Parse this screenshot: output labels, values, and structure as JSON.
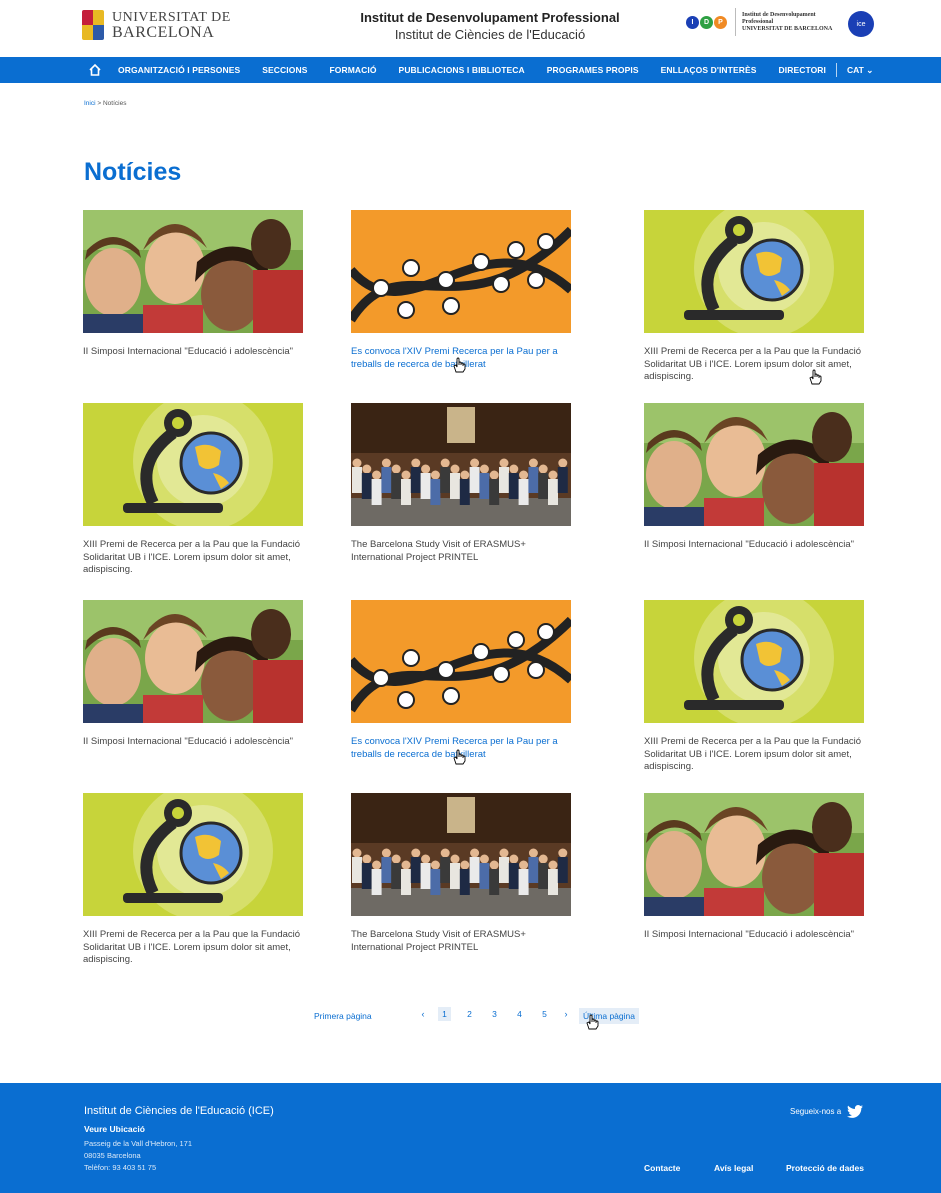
{
  "header": {
    "ub_line1": "UNIVERSITAT DE",
    "ub_line2": "BARCELONA",
    "title_line1": "Institut de Desenvolupament Professional",
    "title_line2": "Institut de Ciències de l'Educació",
    "idp_letters": [
      "I",
      "D",
      "P"
    ],
    "idp_text_line1": "Institut de Desenvolupament",
    "idp_text_line2": "Professional",
    "idp_text_line3": "UNIVERSITAT DE BARCELONA",
    "ice_logo_text": "ice"
  },
  "nav": {
    "items": [
      "ORGANITZACIÓ I PERSONES",
      "SECCIONS",
      "FORMACIÓ",
      "PUBLICACIONS I BIBLIOTECA",
      "PROGRAMES PROPIS",
      "ENLLAÇOS D'INTERÈS",
      "DIRECTORI"
    ],
    "language": "CAT ⌄"
  },
  "breadcrumb": {
    "home": "Inici",
    "separator": ">",
    "current": "Notícies"
  },
  "page_title": "Notícies",
  "cards": [
    {
      "image": "students-selfie",
      "caption": "II Simposi Internacional \"Educació i adolescència\"",
      "link": false
    },
    {
      "image": "dna-orange",
      "caption": "Es convoca l'XIV Premi Recerca per la Pau per a treballs de recerca de batxillerat",
      "link": true
    },
    {
      "image": "microscope-globe",
      "caption": "XIII Premi de Recerca per a la Pau que la Fundació Solidaritat UB i l'ICE. Lorem ipsum dolor sit amet, adispiscing.",
      "link": false
    },
    {
      "image": "microscope-globe",
      "caption": "XIII Premi de Recerca per a la Pau que la Fundació Solidaritat UB i l'ICE. Lorem ipsum dolor sit amet, adispiscing.",
      "link": false
    },
    {
      "image": "group-photo",
      "caption": "The Barcelona Study Visit of ERASMUS+ International Project PRINTEL",
      "link": false
    },
    {
      "image": "students-selfie",
      "caption": "II Simposi Internacional \"Educació i adolescència\"",
      "link": false
    },
    {
      "image": "students-selfie",
      "caption": "II Simposi Internacional \"Educació i adolescència\"",
      "link": false
    },
    {
      "image": "dna-orange",
      "caption": "Es convoca l'XIV Premi Recerca per la Pau per a treballs de recerca de batxillerat",
      "link": true
    },
    {
      "image": "microscope-globe",
      "caption": "XIII Premi de Recerca per a la Pau que la Fundació Solidaritat UB i l'ICE. Lorem ipsum dolor sit amet, adispiscing.",
      "link": false
    },
    {
      "image": "microscope-globe",
      "caption": "XIII Premi de Recerca per a la Pau que la Fundació Solidaritat UB i l'ICE. Lorem ipsum dolor sit amet, adispiscing.",
      "link": false
    },
    {
      "image": "group-photo",
      "caption": "The Barcelona Study Visit of ERASMUS+ International Project PRINTEL",
      "link": false
    },
    {
      "image": "students-selfie",
      "caption": "II Simposi Internacional \"Educació i adolescència\"",
      "link": false
    }
  ],
  "pagination": {
    "first": "Primera pàgina",
    "prev": "‹",
    "pages": [
      "1",
      "2",
      "3",
      "4",
      "5"
    ],
    "current": "1",
    "next": "›",
    "last": "Última pàgina"
  },
  "footer": {
    "title": "Institut de Ciències de l'Educació (ICE)",
    "location_link": "Veure Ubicació",
    "address_line1": "Passeig de la Vall d'Hebron, 171",
    "address_line2": "08035 Barcelona",
    "phone": "Telèfon: 93 403 51 75",
    "social_label": "Segueix-nos a",
    "links": [
      "Contacte",
      "Avís legal",
      "Protecció de dades"
    ]
  },
  "colors": {
    "brand_blue": "#0a6ed1",
    "idp_blue": "#1a3fb5",
    "idp_green": "#2ea043",
    "idp_orange": "#f08a24"
  }
}
